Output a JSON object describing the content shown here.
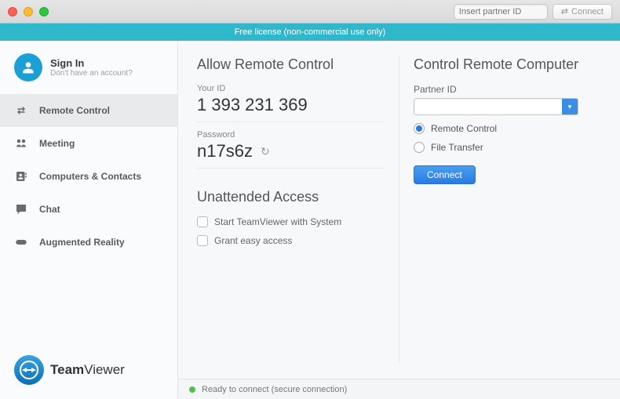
{
  "titlebar": {
    "partner_placeholder": "Insert partner ID",
    "connect_label": "Connect"
  },
  "banner": "Free license (non-commercial use only)",
  "sidebar": {
    "signin": {
      "title": "Sign In",
      "subtitle": "Don't have an account?"
    },
    "items": [
      {
        "label": "Remote Control"
      },
      {
        "label": "Meeting"
      },
      {
        "label": "Computers & Contacts"
      },
      {
        "label": "Chat"
      },
      {
        "label": "Augmented Reality"
      }
    ],
    "logo": {
      "brand_a": "Team",
      "brand_b": "Viewer"
    }
  },
  "main": {
    "allow": {
      "heading": "Allow Remote Control",
      "id_label": "Your ID",
      "id_value": "1 393 231 369",
      "pw_label": "Password",
      "pw_value": "n17s6z"
    },
    "unattended": {
      "heading": "Unattended Access",
      "opt1": "Start TeamViewer with System",
      "opt2": "Grant easy access"
    },
    "control": {
      "heading": "Control Remote Computer",
      "partner_label": "Partner ID",
      "mode_remote": "Remote Control",
      "mode_file": "File Transfer",
      "connect_label": "Connect"
    }
  },
  "status": "Ready to connect (secure connection)"
}
